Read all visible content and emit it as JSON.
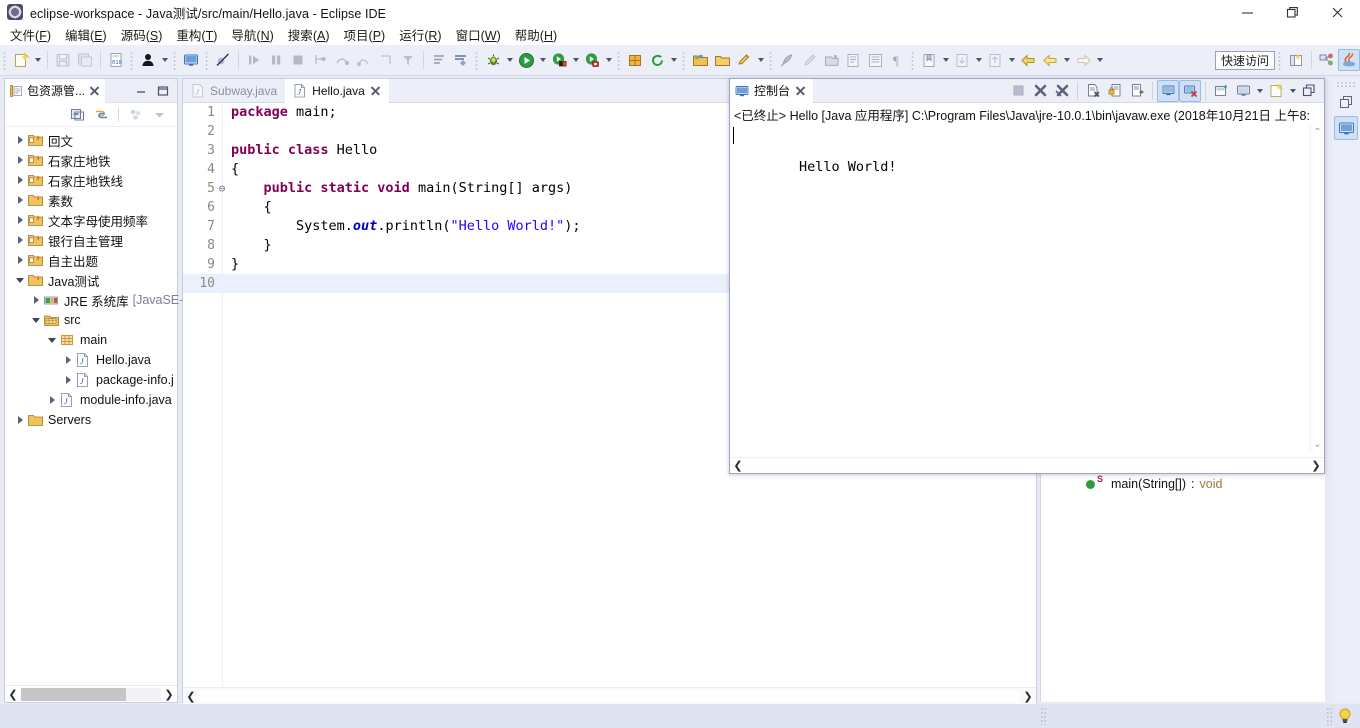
{
  "window": {
    "title": "eclipse-workspace - Java测试/src/main/Hello.java - Eclipse IDE",
    "app_icon": "eclipse-icon",
    "controls": {
      "minimize": "minimize-icon",
      "maximize": "maximize-icon",
      "close": "close-icon"
    }
  },
  "menubar": {
    "items": [
      {
        "label": "文件",
        "mnemonic": "F"
      },
      {
        "label": "编辑",
        "mnemonic": "E"
      },
      {
        "label": "源码",
        "mnemonic": "S"
      },
      {
        "label": "重构",
        "mnemonic": "T"
      },
      {
        "label": "导航",
        "mnemonic": "N"
      },
      {
        "label": "搜索",
        "mnemonic": "A"
      },
      {
        "label": "项目",
        "mnemonic": "P"
      },
      {
        "label": "运行",
        "mnemonic": "R"
      },
      {
        "label": "窗口",
        "mnemonic": "W"
      },
      {
        "label": "帮助",
        "mnemonic": "H"
      }
    ]
  },
  "toolbar": {
    "quick_access_label": "快速访问",
    "icons": [
      "new-wizard-icon",
      "save-icon",
      "save-all-icon",
      "new-java-class-icon",
      "person-icon",
      "console-view-icon",
      "skip-breakpoints-icon",
      "resume-icon",
      "suspend-icon",
      "terminate-icon",
      "step-into-icon",
      "step-over-icon",
      "step-return-icon",
      "drop-to-frame-icon",
      "use-step-filters-icon",
      "open-type-icon",
      "open-task-icon",
      "debug-icon",
      "run-icon",
      "run-external-tools-icon",
      "run-coverage-icon",
      "new-package-icon",
      "refresh-icon",
      "search-icon",
      "open-folder-icon",
      "edit-icon",
      "pin-icon",
      "pen-icon",
      "annotation-icon",
      "outline-icon",
      "book-icon",
      "pilcrow-icon",
      "bookmark-icon",
      "next-annotation-icon",
      "back-icon",
      "forward-icon"
    ],
    "perspective_icons": [
      "open-perspective-icon",
      "java-ee-perspective-icon",
      "java-perspective-icon"
    ]
  },
  "explorer": {
    "tab_label": "包资源管...",
    "toolbar_icons": [
      "collapse-all-icon",
      "link-with-editor-icon",
      "focus-icon",
      "view-menu-icon"
    ],
    "min_max_icons": [
      "minimize-icon",
      "maximize-icon"
    ],
    "tree": [
      {
        "label": "回文",
        "icon": "java-project-icon",
        "indent": 0,
        "state": "collapsed"
      },
      {
        "label": "石家庄地铁",
        "icon": "java-project-icon",
        "indent": 0,
        "state": "collapsed"
      },
      {
        "label": "石家庄地铁线",
        "icon": "java-project-icon",
        "indent": 0,
        "state": "collapsed"
      },
      {
        "label": "素数",
        "icon": "java-project-icon",
        "indent": 0,
        "state": "collapsed"
      },
      {
        "label": "文本字母使用频率",
        "icon": "java-project-icon",
        "indent": 0,
        "state": "collapsed"
      },
      {
        "label": "银行自主管理",
        "icon": "java-project-icon",
        "indent": 0,
        "state": "collapsed"
      },
      {
        "label": "自主出题",
        "icon": "java-project-icon",
        "indent": 0,
        "state": "collapsed"
      },
      {
        "label": "Java测试",
        "icon": "java-project-icon",
        "indent": 0,
        "state": "expanded"
      },
      {
        "label": "JRE 系统库",
        "label_extra": "[JavaSE-",
        "icon": "jre-library-icon",
        "indent": 1,
        "state": "collapsed"
      },
      {
        "label": "src",
        "icon": "source-folder-icon",
        "indent": 1,
        "state": "expanded"
      },
      {
        "label": "main",
        "icon": "package-icon",
        "indent": 2,
        "state": "expanded"
      },
      {
        "label": "Hello.java",
        "icon": "java-file-icon",
        "indent": 3,
        "state": "collapsed"
      },
      {
        "label": "package-info.j",
        "icon": "java-file-icon",
        "indent": 3,
        "state": "collapsed"
      },
      {
        "label": "module-info.java",
        "icon": "java-file-icon",
        "indent": 2,
        "state": "collapsed"
      },
      {
        "label": "Servers",
        "icon": "folder-icon",
        "indent": 0,
        "state": "collapsed"
      }
    ],
    "hscroll": {
      "left_arrow": "scroll-left-icon",
      "right_arrow": "scroll-right-icon"
    }
  },
  "editor": {
    "tabs": [
      {
        "label": "Subway.java",
        "icon": "java-file-icon",
        "active": false,
        "closable": false
      },
      {
        "label": "Hello.java",
        "icon": "java-file-icon",
        "active": true,
        "closable": true
      }
    ],
    "lines": [
      {
        "num": "1",
        "fold": "",
        "text": "package main;",
        "highlight": false
      },
      {
        "num": "2",
        "fold": "",
        "text": "",
        "highlight": false
      },
      {
        "num": "3",
        "fold": "",
        "text": "public class Hello",
        "highlight": false
      },
      {
        "num": "4",
        "fold": "",
        "text": "{",
        "highlight": false
      },
      {
        "num": "5",
        "fold": "⊖",
        "text": "    public static void main(String[] args)",
        "highlight": false
      },
      {
        "num": "6",
        "fold": "",
        "text": "    {",
        "highlight": false
      },
      {
        "num": "7",
        "fold": "",
        "text": "        System.out.println(\"Hello World!\");",
        "highlight": false
      },
      {
        "num": "8",
        "fold": "",
        "text": "    }",
        "highlight": false
      },
      {
        "num": "9",
        "fold": "",
        "text": "}",
        "highlight": false
      },
      {
        "num": "10",
        "fold": "",
        "text": "",
        "highlight": true
      }
    ]
  },
  "console": {
    "tab_label": "控制台",
    "tab_icon": "console-icon",
    "toolbar_icons": [
      "terminate-icon",
      "remove-launch-icon",
      "remove-all-launches-icon",
      "clear-console-icon",
      "scroll-lock-icon",
      "word-wrap-icon",
      "show-console-on-output-icon",
      "show-console-on-error-icon",
      "pin-console-icon",
      "display-selected-console-icon",
      "display-console-menu-icon",
      "open-console-icon",
      "open-console-menu-icon",
      "restore-icon"
    ],
    "launch_info": "<已终止> Hello [Java 应用程序] C:\\Program Files\\Java\\jre-10.0.1\\bin\\javaw.exe  (2018年10月21日 上午8:",
    "output": "Hello World!",
    "vscroll": {
      "up": "scroll-up-icon",
      "down": "scroll-down-icon"
    },
    "hscroll": {
      "left": "scroll-left-icon",
      "right": "scroll-right-icon"
    }
  },
  "outline": {
    "items": [
      {
        "label": "main(String[])",
        "separator": " : ",
        "type": "void",
        "icon": "public-method-icon",
        "modifier": "S"
      }
    ]
  },
  "right_strip": {
    "buttons": [
      {
        "icon": "restore-view-icon",
        "selected": false
      },
      {
        "icon": "console-view-icon",
        "selected": true
      }
    ]
  },
  "statusbar": {
    "icons": [
      "tip-bulb-icon"
    ]
  },
  "colors": {
    "chrome": "#eceef8",
    "panel_border": "#c8cde0",
    "selection_blue": "#cfe0f7",
    "keyword": "#7f0055",
    "string": "#2a00ff",
    "field": "#0000c0",
    "line_highlight": "#e8f1fd",
    "statusbar": "#dfe3f2"
  }
}
